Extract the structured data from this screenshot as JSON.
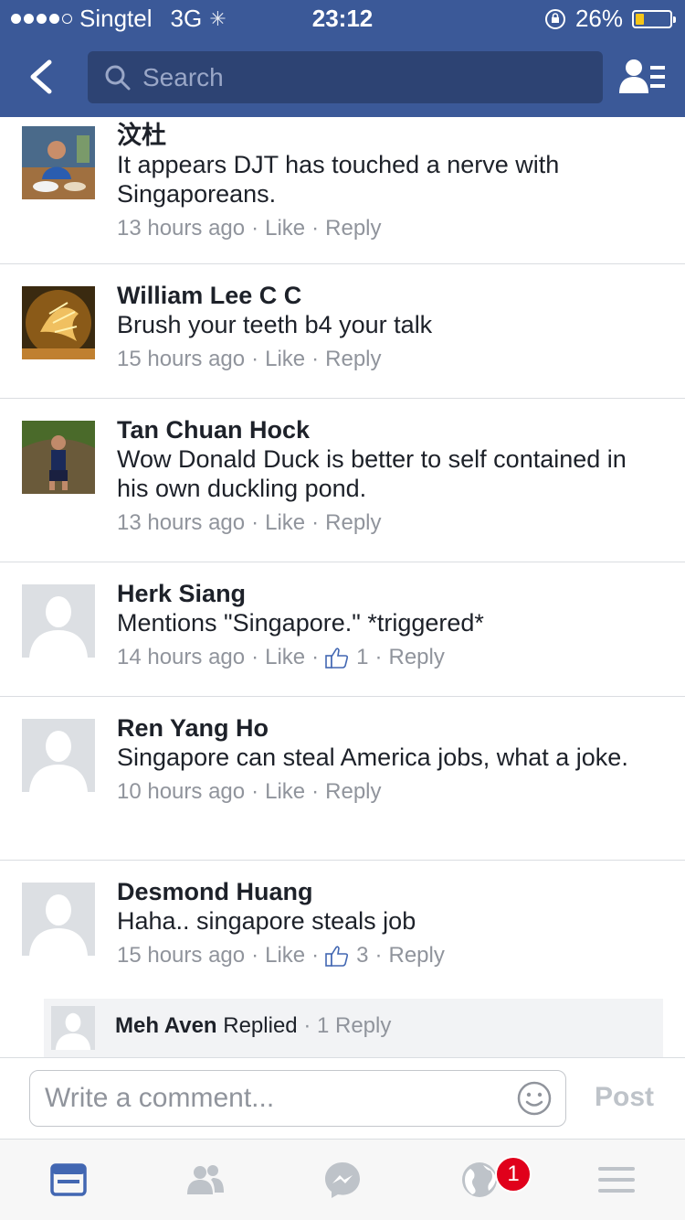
{
  "status_bar": {
    "carrier": "Singtel",
    "network": "3G",
    "time": "23:12",
    "battery": "26%",
    "battery_level": 0.26,
    "signal_bars": 4
  },
  "nav": {
    "search_placeholder": "Search"
  },
  "comments": [
    {
      "name": "汶杜",
      "text": "It appears DJT has touched a nerve with Singaporeans.",
      "time": "13 hours ago",
      "like": "Like",
      "reply": "Reply",
      "likes": ""
    },
    {
      "name": "William Lee C C",
      "text": "Brush your teeth b4 your talk",
      "time": "15 hours ago",
      "like": "Like",
      "reply": "Reply",
      "likes": ""
    },
    {
      "name": "Tan Chuan Hock",
      "text": "Wow Donald Duck is better to self contained in his own duckling pond.",
      "time": "13 hours ago",
      "like": "Like",
      "reply": "Reply",
      "likes": ""
    },
    {
      "name": "Herk Siang",
      "text": "Mentions \"Singapore.\" *triggered*",
      "time": "14 hours ago",
      "like": "Like",
      "reply": "Reply",
      "likes": "1"
    },
    {
      "name": "Ren Yang Ho",
      "text": "Singapore can steal America jobs, what a joke.",
      "time": "10 hours ago",
      "like": "Like",
      "reply": "Reply",
      "likes": ""
    },
    {
      "name": "Desmond Huang",
      "text": "Haha.. singapore steals job",
      "time": "15 hours ago",
      "like": "Like",
      "reply": "Reply",
      "likes": "3"
    }
  ],
  "reply_preview": {
    "name": "Meh Aven",
    "action": "Replied",
    "count": "1 Reply"
  },
  "composer": {
    "placeholder": "Write a comment...",
    "post_label": "Post"
  },
  "tabbar": {
    "notification_badge": "1"
  },
  "colors": {
    "brand": "#3b5998",
    "link_gray": "#90949c",
    "badge": "#e0001b"
  }
}
